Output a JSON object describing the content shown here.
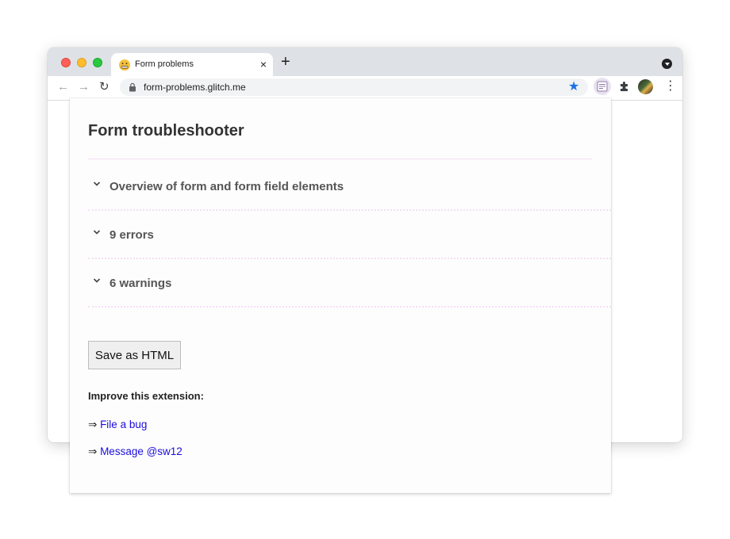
{
  "browser": {
    "tab": {
      "title": "Form problems",
      "close_glyph": "×",
      "favicon": "grimacing-face-icon"
    },
    "new_tab_glyph": "+",
    "nav": {
      "back": "←",
      "forward": "→",
      "reload": "↻"
    },
    "address_bar": {
      "url": "form-problems.glitch.me"
    },
    "bookmark_star": "★",
    "menu_glyph": "⋮",
    "colors": {
      "accent": "#1a73e8",
      "tabstrip": "#dee1e6"
    }
  },
  "popup": {
    "title": "Form troubleshooter",
    "sections": [
      {
        "label": "Overview of form and form field elements"
      },
      {
        "label": "9 errors"
      },
      {
        "label": "6 warnings"
      }
    ],
    "save_button": "Save as HTML",
    "improve_heading": "Improve this extension:",
    "arrow": "⇒",
    "links": [
      {
        "label": "File a bug"
      },
      {
        "label": "Message @sw12"
      }
    ],
    "colors": {
      "link": "#1a0dde",
      "divider": "#f5def5"
    }
  }
}
